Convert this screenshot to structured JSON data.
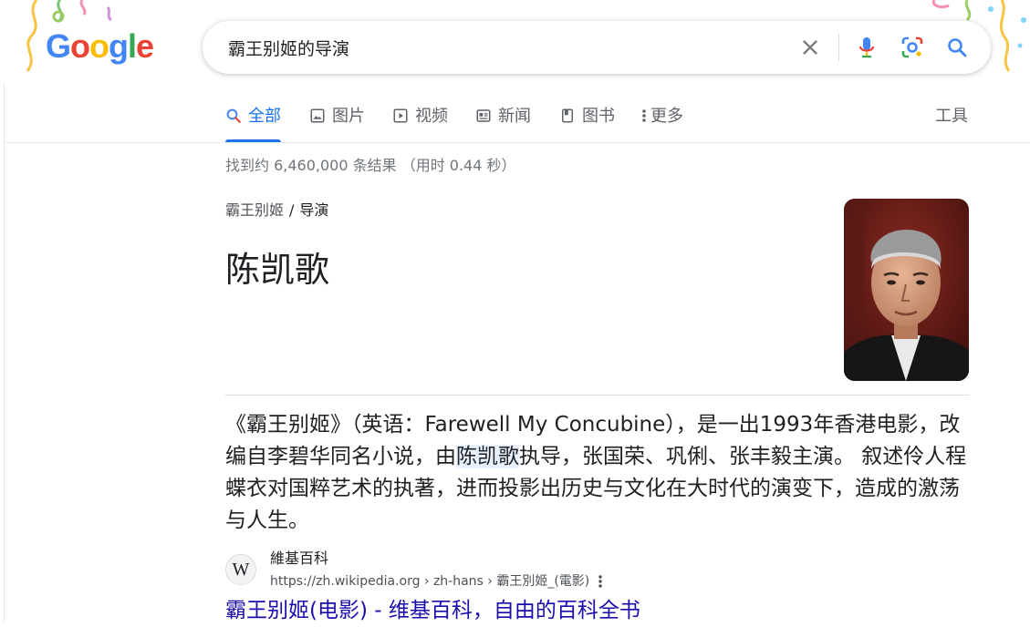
{
  "header": {
    "logo_letters": [
      {
        "ch": "G",
        "color": "#4285f4"
      },
      {
        "ch": "o",
        "color": "#ea4335"
      },
      {
        "ch": "o",
        "color": "#fbbc05"
      },
      {
        "ch": "g",
        "color": "#4285f4"
      },
      {
        "ch": "l",
        "color": "#34a853"
      },
      {
        "ch": "e",
        "color": "#ea4335"
      }
    ],
    "search": {
      "value": "霸王别姬的导演",
      "clear_icon": "close-icon",
      "voice_icon": "microphone-icon",
      "lens_icon": "camera-lens-icon",
      "search_icon": "search-icon"
    }
  },
  "tabs": [
    {
      "label": "全部",
      "icon": "search-icon",
      "active": true
    },
    {
      "label": "图片",
      "icon": "image-icon",
      "active": false
    },
    {
      "label": "视频",
      "icon": "video-icon",
      "active": false
    },
    {
      "label": "新闻",
      "icon": "news-icon",
      "active": false
    },
    {
      "label": "图书",
      "icon": "book-icon",
      "active": false
    },
    {
      "label": "更多",
      "icon": "more-vertical-icon",
      "active": false
    }
  ],
  "tools_label": "工具",
  "result_stats": "找到约 6,460,000 条结果 （用时 0.44 秒）",
  "featured": {
    "breadcrumb": {
      "parent": "霸王别姬",
      "separator": "/",
      "current": "导演"
    },
    "answer": "陈凯歌",
    "snippet": {
      "before": "《霸王别姬》（英语：Farewell My Concubine），是一出1993年香港电影，改编自李碧华同名小说，由",
      "highlight": "陈凯歌",
      "after": "执导，张国荣、巩俐、张丰毅主演。 叙述伶人程蝶衣对国粹艺术的执著，进而投影出历史与文化在大时代的演变下，造成的激荡与人生。"
    },
    "source": {
      "favicon_letter": "W",
      "name": "維基百科",
      "url": "https://zh.wikipedia.org › zh-hans › 霸王別姬_(電影)"
    },
    "result_title": "霸王别姬(电影) - 维基百科，自由的百科全书"
  },
  "colors": {
    "accent": "#1a73e8",
    "link": "#1a0dab",
    "highlight": "#e8f0fe"
  }
}
